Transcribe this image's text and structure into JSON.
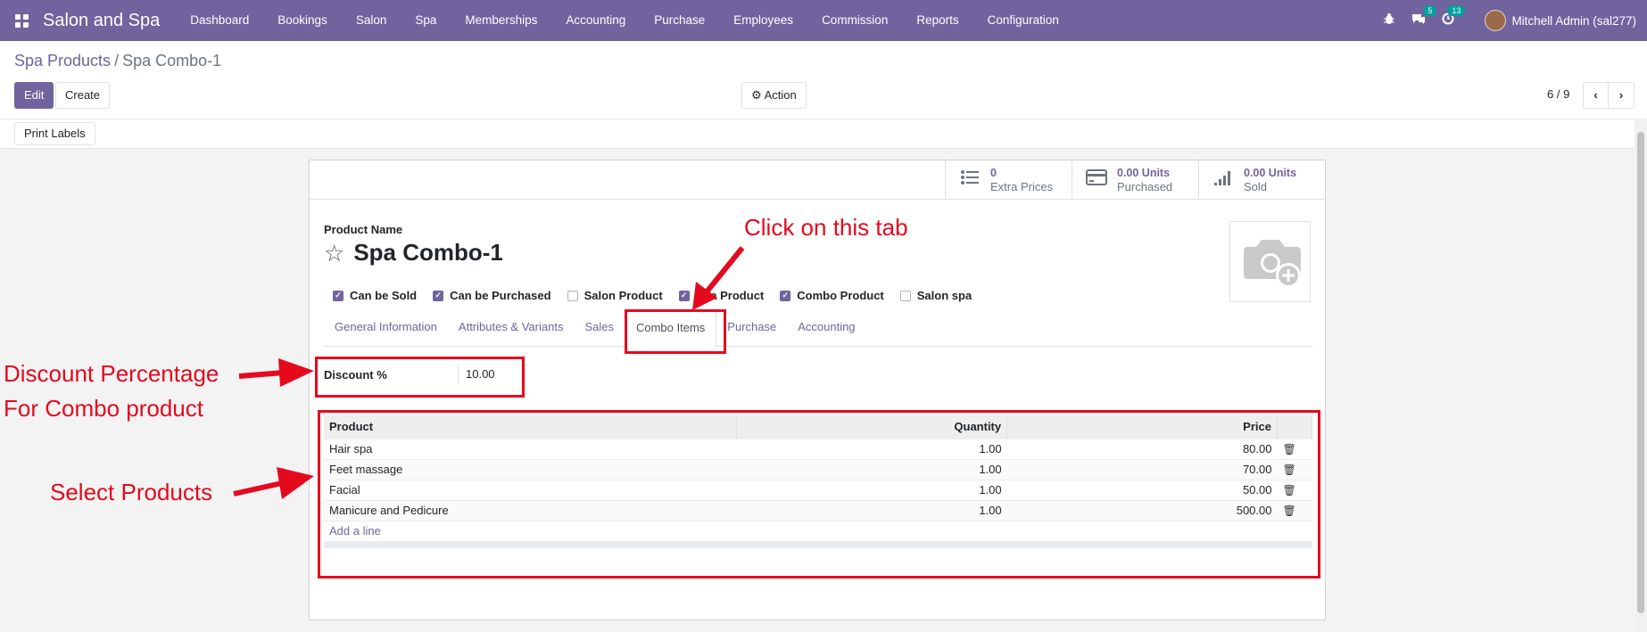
{
  "navbar": {
    "app_name": "Salon and Spa",
    "menu": [
      "Dashboard",
      "Bookings",
      "Salon",
      "Spa",
      "Memberships",
      "Accounting",
      "Purchase",
      "Employees",
      "Commission",
      "Reports",
      "Configuration"
    ],
    "messages_count": "5",
    "activities_count": "13",
    "user": "Mitchell Admin (sal277)",
    "accent": "#71639e"
  },
  "breadcrumb": {
    "parent": "Spa Products",
    "separator": "/",
    "current": "Spa Combo-1"
  },
  "toolbar": {
    "edit": "Edit",
    "create": "Create",
    "action": "Action",
    "pager": "6 / 9",
    "print_labels": "Print Labels"
  },
  "stats": [
    {
      "value": "0",
      "label": "Extra Prices",
      "icon": "list-icon"
    },
    {
      "value": "0.00 Units",
      "label": "Purchased",
      "icon": "credit-card-icon"
    },
    {
      "value": "0.00 Units",
      "label": "Sold",
      "icon": "signal-icon"
    }
  ],
  "product": {
    "name_label": "Product Name",
    "name": "Spa Combo-1",
    "flags": [
      {
        "label": "Can be Sold",
        "checked": true
      },
      {
        "label": "Can be Purchased",
        "checked": true
      },
      {
        "label": "Salon Product",
        "checked": false
      },
      {
        "label": "Spa Product",
        "checked": true
      },
      {
        "label": "Combo Product",
        "checked": true
      },
      {
        "label": "Salon spa",
        "checked": false
      }
    ]
  },
  "tabs": [
    "General Information",
    "Attributes & Variants",
    "Sales",
    "Combo Items",
    "Purchase",
    "Accounting"
  ],
  "active_tab": "Combo Items",
  "discount": {
    "label": "Discount %",
    "value": "10.00"
  },
  "combo_table": {
    "headers": [
      "Product",
      "Quantity",
      "Price"
    ],
    "rows": [
      {
        "product": "Hair spa",
        "quantity": "1.00",
        "price": "80.00"
      },
      {
        "product": "Feet massage",
        "quantity": "1.00",
        "price": "70.00"
      },
      {
        "product": "Facial",
        "quantity": "1.00",
        "price": "50.00"
      },
      {
        "product": "Manicure and Pedicure",
        "quantity": "1.00",
        "price": "500.00"
      }
    ],
    "add_line": "Add a line"
  },
  "annotations": {
    "click_tab": "Click on this tab",
    "discount_line1": "Discount Percentage",
    "discount_line2": "For Combo product",
    "select_products": "Select Products",
    "color": "#e5091e"
  }
}
